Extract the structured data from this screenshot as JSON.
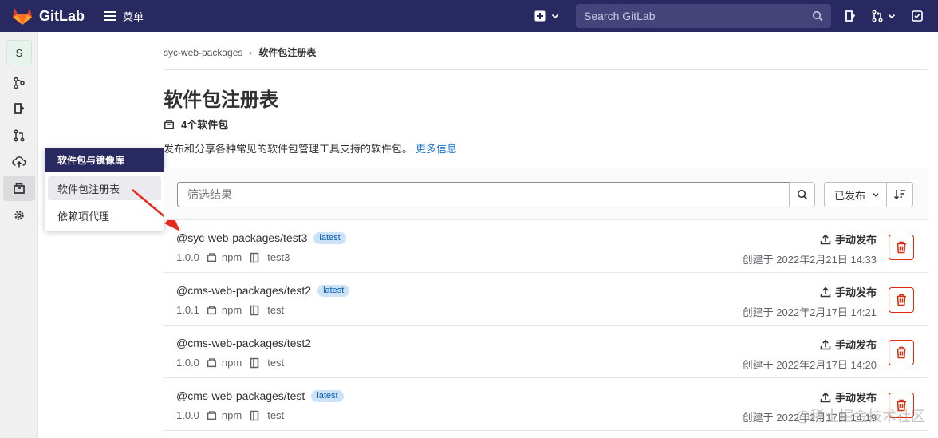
{
  "topbar": {
    "app_name": "GitLab",
    "menu_label": "菜单",
    "search_placeholder": "Search GitLab"
  },
  "sidebar": {
    "project_initial": "S"
  },
  "flyout": {
    "title": "软件包与镜像库",
    "items": [
      "软件包注册表",
      "依赖项代理"
    ]
  },
  "breadcrumb": {
    "project": "syc-web-packages",
    "current": "软件包注册表"
  },
  "page": {
    "title": "软件包注册表",
    "count_label": "4个软件包",
    "description": "发布和分享各种常见的软件包管理工具支持的软件包。",
    "more_info": "更多信息"
  },
  "filter": {
    "placeholder": "筛选结果",
    "sort_label": "已发布"
  },
  "packages": [
    {
      "name": "@syc-web-packages/test3",
      "badge": "latest",
      "version": "1.0.0",
      "type": "npm",
      "project": "test3",
      "publish_label": "手动发布",
      "created": "创建于 2022年2月21日 14:33"
    },
    {
      "name": "@cms-web-packages/test2",
      "badge": "latest",
      "version": "1.0.1",
      "type": "npm",
      "project": "test",
      "publish_label": "手动发布",
      "created": "创建于 2022年2月17日 14:21"
    },
    {
      "name": "@cms-web-packages/test2",
      "badge": "",
      "version": "1.0.0",
      "type": "npm",
      "project": "test",
      "publish_label": "手动发布",
      "created": "创建于 2022年2月17日 14:20"
    },
    {
      "name": "@cms-web-packages/test",
      "badge": "latest",
      "version": "1.0.0",
      "type": "npm",
      "project": "test",
      "publish_label": "手动发布",
      "created": "创建于 2022年2月17日 14:19"
    }
  ],
  "watermark": "@稀土掘金技术社区",
  "colors": {
    "navbar": "#292961",
    "link": "#1f75cb",
    "danger": "#dd2b0e",
    "badge_bg": "#cbe2f9"
  }
}
